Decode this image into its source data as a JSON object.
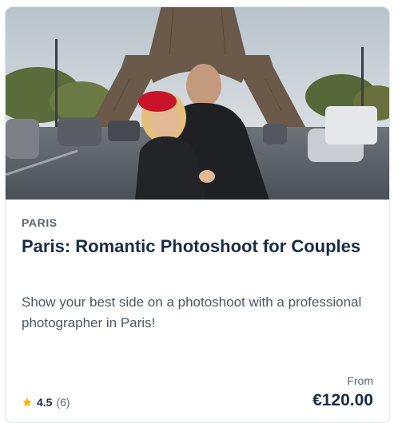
{
  "card": {
    "image_alt": "Couple posing in front of the Eiffel Tower",
    "location": "PARIS",
    "title": "Paris: Romantic Photoshoot for Couples",
    "description": "Show your best side on a photoshoot with a professional photographer in Paris!",
    "rating": {
      "icon": "star-icon",
      "value": "4.5",
      "count": "(6)"
    },
    "price": {
      "prefix": "From",
      "amount": "€120.00"
    }
  },
  "colors": {
    "title": "#1a2b49",
    "text_secondary": "#5c6670",
    "star": "#ffb300",
    "border": "#e3e6ea"
  }
}
